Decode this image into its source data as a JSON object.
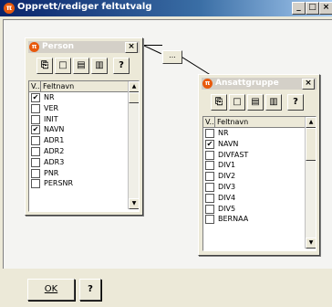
{
  "window": {
    "title": "Opprett/rediger feltutvalg",
    "app_icon": "app-icon",
    "min_label": "_",
    "max_label": "□",
    "close_label": "×"
  },
  "connector_button": {
    "label": "..."
  },
  "person": {
    "title": "Person",
    "close_label": "×",
    "toolbar": [
      {
        "icon": "properties-icon",
        "glyph": "⎘"
      },
      {
        "icon": "new-doc-icon",
        "glyph": "□"
      },
      {
        "icon": "select-all-icon",
        "glyph": "▤"
      },
      {
        "icon": "deselect-icon",
        "glyph": "▥"
      },
      {
        "icon": "help-icon",
        "glyph": "?"
      }
    ],
    "col_check": "V..",
    "col_name": "Feltnavn",
    "rows": [
      {
        "label": "NR",
        "checked": true
      },
      {
        "label": "VER",
        "checked": false
      },
      {
        "label": "INIT",
        "checked": false
      },
      {
        "label": "NAVN",
        "checked": true
      },
      {
        "label": "ADR1",
        "checked": false
      },
      {
        "label": "ADR2",
        "checked": false
      },
      {
        "label": "ADR3",
        "checked": false
      },
      {
        "label": "PNR",
        "checked": false
      },
      {
        "label": "PERSNR",
        "checked": false
      }
    ]
  },
  "ansattgruppe": {
    "title": "Ansattgruppe",
    "close_label": "×",
    "toolbar": [
      {
        "icon": "properties-icon",
        "glyph": "⎘"
      },
      {
        "icon": "new-doc-icon",
        "glyph": "□"
      },
      {
        "icon": "select-all-icon",
        "glyph": "▤"
      },
      {
        "icon": "deselect-icon",
        "glyph": "▥"
      },
      {
        "icon": "help-icon",
        "glyph": "?"
      }
    ],
    "col_check": "V..",
    "col_name": "Feltnavn",
    "rows": [
      {
        "label": "NR",
        "checked": false
      },
      {
        "label": "NAVN",
        "checked": true
      },
      {
        "label": "DIVFAST",
        "checked": false
      },
      {
        "label": "DIV1",
        "checked": false
      },
      {
        "label": "DIV2",
        "checked": false
      },
      {
        "label": "DIV3",
        "checked": false
      },
      {
        "label": "DIV4",
        "checked": false
      },
      {
        "label": "DIV5",
        "checked": false
      },
      {
        "label": "BERNAA",
        "checked": false
      }
    ]
  },
  "footer": {
    "ok_label": "OK",
    "help_label": "?"
  },
  "colors": {
    "titlebar": "#0a246a",
    "panel_title_inactive": "#d4d0c8",
    "face": "#ece9d8"
  }
}
